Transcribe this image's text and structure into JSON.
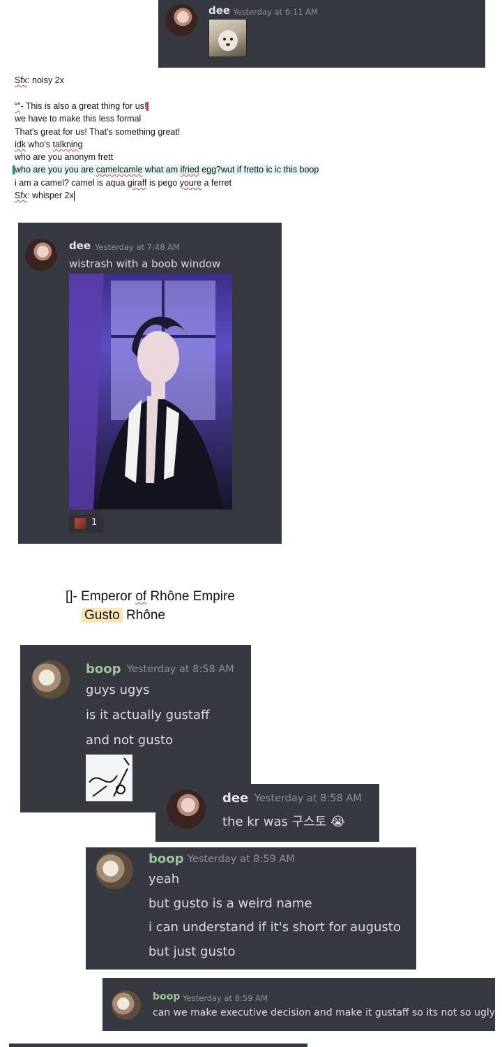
{
  "card1": {
    "name": "dee",
    "timestamp": "Yesterday at 6:11 AM",
    "image_desc": "dog-photo"
  },
  "doc": {
    "line1": {
      "sfx": "Sfx",
      "rest": ": noisy 2x"
    },
    "line2": {
      "quote": "“”",
      "rest": "- This is also a great thing for us!"
    },
    "line3": "we have to make this less formal",
    "line4": "That's great for us! That's something great!",
    "line5": {
      "idk": "idk",
      "mid": " who's ",
      "talkning": "talkning"
    },
    "line6": "who are you anonym frett",
    "line7": {
      "a": "who are you you are ",
      "camelcamle": "camelcamle",
      "b": " what am ",
      "ifried": "ifried",
      "c": " egg?wut if fretto ic ic this boop"
    },
    "line8": {
      "a": "i am a camel? camel is aqua ",
      "giraff": "giraff",
      "b": " is pego ",
      "youre": "youre",
      "c": " a ferret"
    },
    "line9": {
      "sfx": "Sfx",
      "rest": ": whisper 2x"
    }
  },
  "card2": {
    "name": "dee",
    "timestamp": "Yesterday at 7:48 AM",
    "message": "wistrash with a boob window",
    "reaction_count": "1"
  },
  "title": {
    "bracket": "[]- Emperor ",
    "of": "of",
    "rest": " Rhône Empire",
    "gusto": "Gusto",
    "rhone": " Rhône"
  },
  "card3": {
    "name": "boop",
    "timestamp": "Yesterday at 8:58 AM",
    "lines": [
      "guys ugys",
      "is it actually gustaff",
      "and not gusto"
    ]
  },
  "card4": {
    "name": "dee",
    "timestamp": "Yesterday at 8:58 AM",
    "message": "the kr was 구스토",
    "emoji": "😭"
  },
  "card5": {
    "name": "boop",
    "timestamp": "Yesterday at 8:59 AM",
    "lines": [
      "yeah",
      "but gusto is a weird name",
      "i can understand if it's short for augusto",
      "but just gusto"
    ]
  },
  "card6": {
    "name": "boop",
    "timestamp": "Yesterday at 8:59 AM",
    "message": "can we make executive decision and make it gustaff so its not so ugly"
  },
  "colors": {
    "card_bg": "#36393f",
    "boop_name": "#9bc59b",
    "timestamp": "#8e9297",
    "message": "#dcddde"
  }
}
